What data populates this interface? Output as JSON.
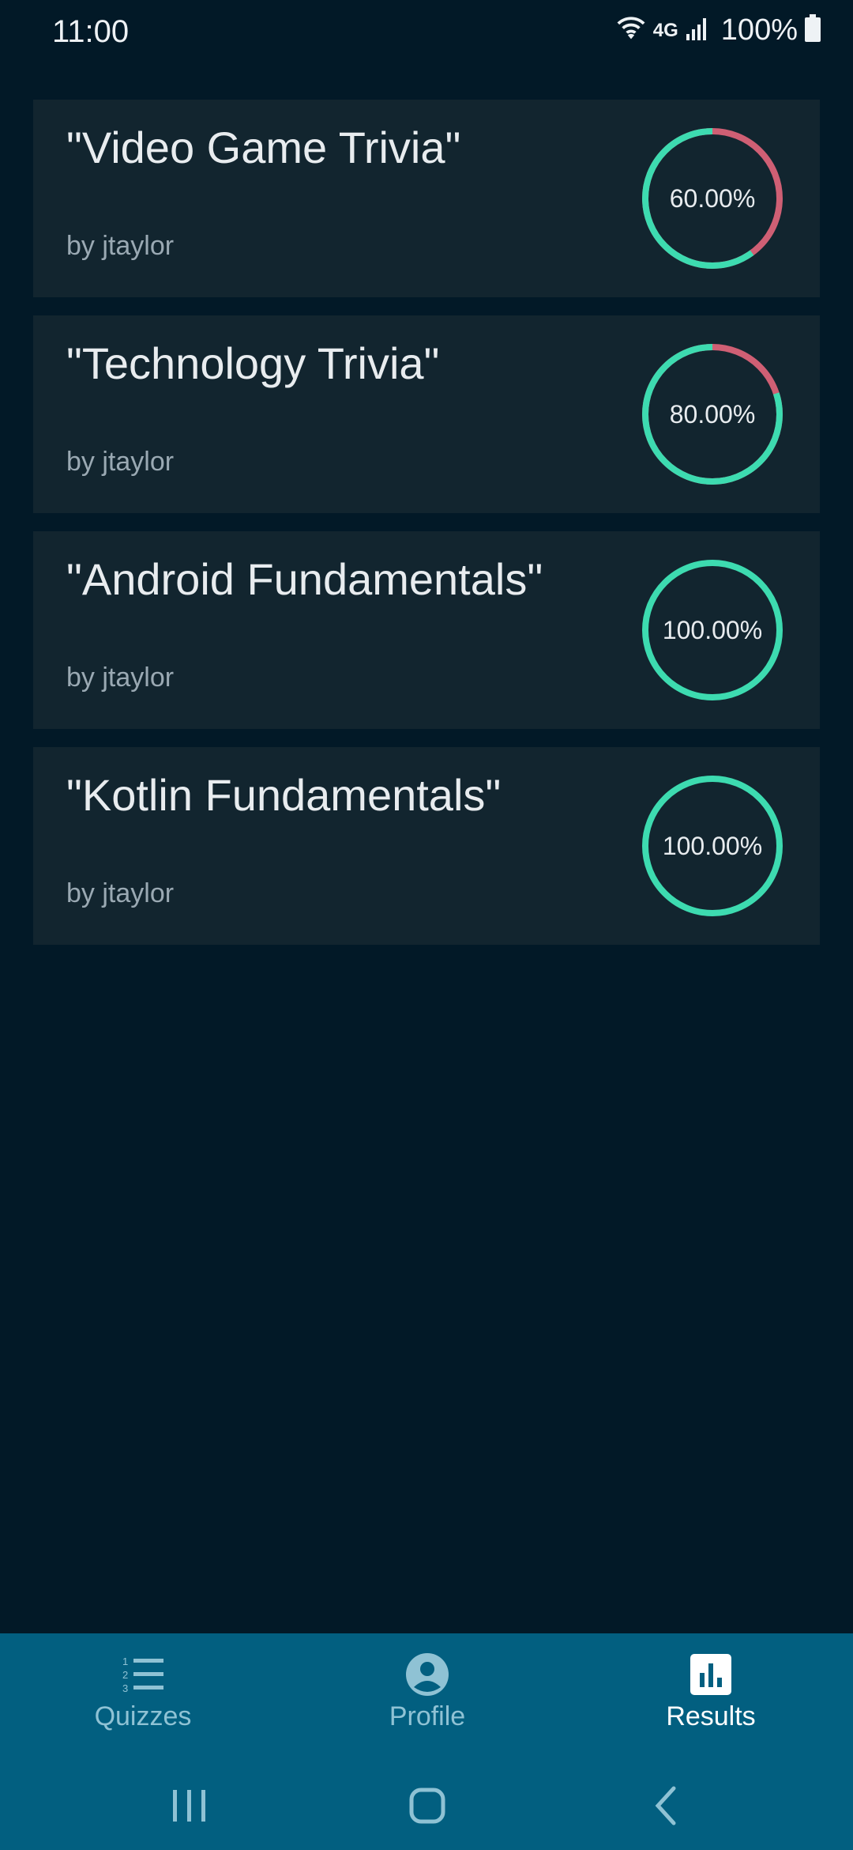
{
  "status_bar": {
    "time": "11:00",
    "network": "4G",
    "battery": "100%"
  },
  "results": [
    {
      "title": "\"Video Game Trivia\"",
      "author": "by jtaylor",
      "score_label": "60.00%",
      "score": 0.6
    },
    {
      "title": "\"Technology Trivia\"",
      "author": "by jtaylor",
      "score_label": "80.00%",
      "score": 0.8
    },
    {
      "title": "\"Android Fundamentals\"",
      "author": "by jtaylor",
      "score_label": "100.00%",
      "score": 1.0
    },
    {
      "title": "\"Kotlin Fundamentals\"",
      "author": "by jtaylor",
      "score_label": "100.00%",
      "score": 1.0
    }
  ],
  "bottom_nav": {
    "items": [
      {
        "label": "Quizzes",
        "icon": "numbered-list-icon",
        "active": false
      },
      {
        "label": "Profile",
        "icon": "account-circle-icon",
        "active": false
      },
      {
        "label": "Results",
        "icon": "bar-chart-icon",
        "active": true
      }
    ]
  },
  "colors": {
    "background": "#021927",
    "card": "#12252f",
    "correct": "#3ddbb0",
    "incorrect": "#cf5f74",
    "nav_bar": "#025f80"
  }
}
